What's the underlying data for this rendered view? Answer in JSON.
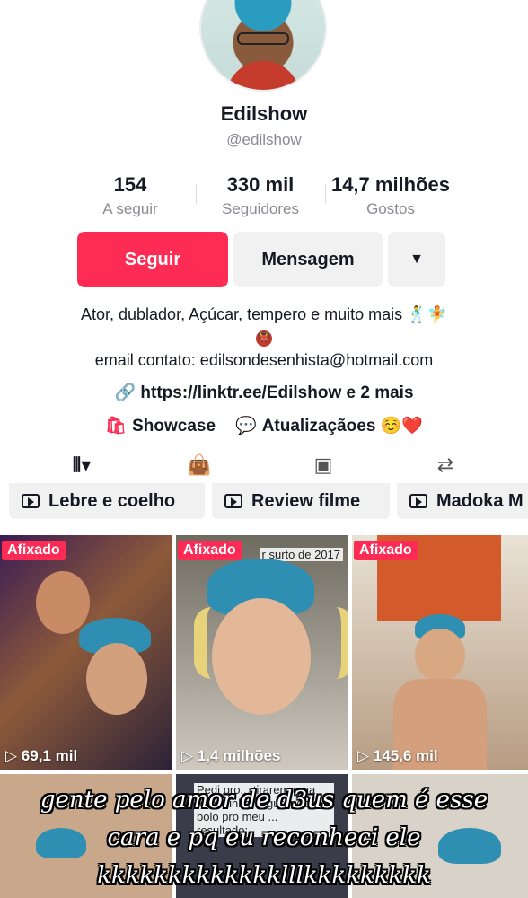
{
  "profile": {
    "name": "Edilshow",
    "handle": "@edilshow",
    "stats": [
      {
        "value": "154",
        "label": "A seguir"
      },
      {
        "value": "330 mil",
        "label": "Seguidores"
      },
      {
        "value": "14,7 milhões",
        "label": "Gostos"
      }
    ],
    "follow_label": "Seguir",
    "message_label": "Mensagem",
    "more_icon": "▼",
    "bio_line1": "Ator, dublador, Açúcar, tempero e muito mais 🕺🧚",
    "bio_badge": "👹",
    "email_line": "email contato: edilsondesenhista@hotmail.com",
    "link_text": "https://linktr.ee/Edilshow e 2 mais",
    "showcase_label": "Showcase",
    "updates_label": "Atualizaçãoes ☺️❤️"
  },
  "tabs": [
    "grid-icon",
    "shop-bag-icon",
    "favorites-icon",
    "repost-icon"
  ],
  "playlists": [
    "Lebre e coelho",
    "Review filme",
    "Madoka M"
  ],
  "videos": [
    {
      "pinned": "Afixado",
      "views": "▷ 69,1 mil"
    },
    {
      "pinned": "Afixado",
      "views": "▷ 1,4 milhões",
      "overlay": "r surto de 2017"
    },
    {
      "pinned": "Afixado",
      "views": "▷ 145,6 mil"
    }
  ],
  "second_row_text": "Pedi pro... tirarem uma foto minha segurando o bolo pro meu ... resultado:",
  "caption": {
    "line1": "gente pelo amor de d3us quem é esse",
    "line2": "cara e pq eu reconheci ele",
    "line3": "kkkkkkkkkkkkklllkkkkkkkkk"
  },
  "colors": {
    "accent": "#fe2c55",
    "muted": "#8a8b91",
    "button_bg": "#f1f1f2"
  }
}
